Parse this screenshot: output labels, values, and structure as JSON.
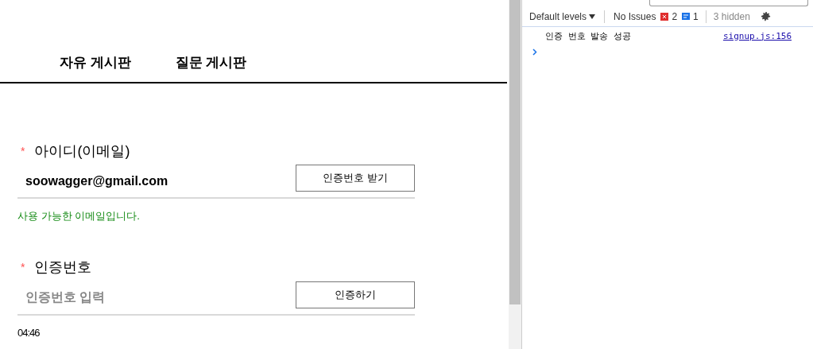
{
  "nav": [
    {
      "label": "자유 게시판"
    },
    {
      "label": "질문 게시판"
    }
  ],
  "form": [
    {
      "label": "아이디(이메일)",
      "required_mark": "*",
      "value": "soowagger@gmail.com",
      "button": "인증번호 받기",
      "message": "사용 가능한 이메일입니다."
    },
    {
      "label": "인증번호",
      "required_mark": "*",
      "placeholder": "인증번호 입력",
      "button": "인증하기",
      "timer": "04:46"
    }
  ],
  "devtools": {
    "levels": "Default levels",
    "issues_label": "No Issues",
    "error_count": "2",
    "info_count": "1",
    "hidden": "3 hidden",
    "messages": [
      {
        "text": "인증 번호 발송 성공",
        "source": "signup.js:156"
      }
    ]
  }
}
